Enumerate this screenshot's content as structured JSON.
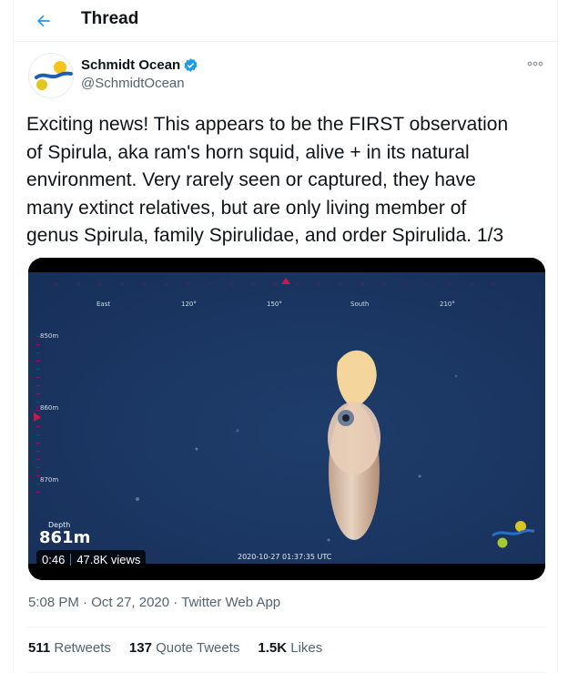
{
  "header": {
    "title": "Thread",
    "back_icon": "arrow-left-icon",
    "accent": "#1d9bf0"
  },
  "author": {
    "name": "Schmidt Ocean",
    "handle": "@SchmidtOcean",
    "verified": true,
    "verified_icon": "verified-badge-icon",
    "more_icon": "more-options-icon"
  },
  "tweet": {
    "lines": [
      "Exciting news! This appears to be the FIRST observation",
      "of Spirula, aka ram's horn squid, alive + in its natural",
      "environment. Very rarely seen or captured, they have",
      "many extinct relatives, but are only living member of",
      "genus Spirula, family Spirulidae, and order Spirulida. 1/3"
    ]
  },
  "video": {
    "compass": [
      "East",
      "120°",
      "150°",
      "South",
      "210°"
    ],
    "depth_scale": [
      "850m",
      "860m",
      "870m"
    ],
    "depth_label": "Depth",
    "depth_value": "861m",
    "timestamp": "2020-10-27 01:37:35 UTC",
    "duration": "0:46",
    "views": "47.8K views"
  },
  "meta": {
    "time": "5:08 PM",
    "date": "Oct 27, 2020",
    "source": "Twitter Web App",
    "dot": "·"
  },
  "stats": {
    "retweets_count": "511",
    "retweets_label": "Retweets",
    "quotes_count": "137",
    "quotes_label": "Quote Tweets",
    "likes_count": "1.5K",
    "likes_label": "Likes"
  }
}
